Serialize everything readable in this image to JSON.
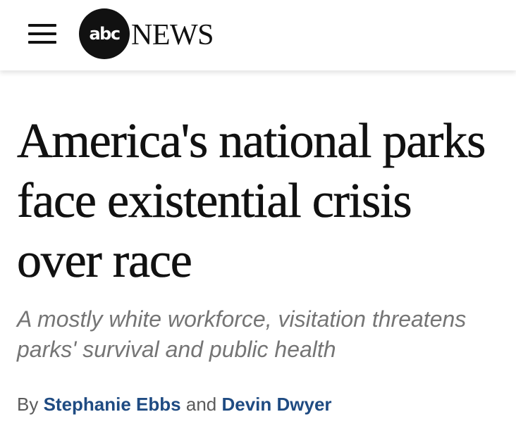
{
  "header": {
    "logo": {
      "circle_text": "abc",
      "wordmark": "NEWS"
    }
  },
  "article": {
    "headline": "America's national parks face existential crisis over race",
    "dek": "A mostly white workforce, visitation threatens parks' survival and public health",
    "byline": {
      "prefix": "By",
      "author1": "Stephanie Ebbs",
      "conjunction": "and",
      "author2": "Devin Dwyer"
    }
  },
  "colors": {
    "headline": "#111111",
    "dek": "#757575",
    "author_link": "#1f4b82",
    "byline_text": "#5a5a5a"
  }
}
